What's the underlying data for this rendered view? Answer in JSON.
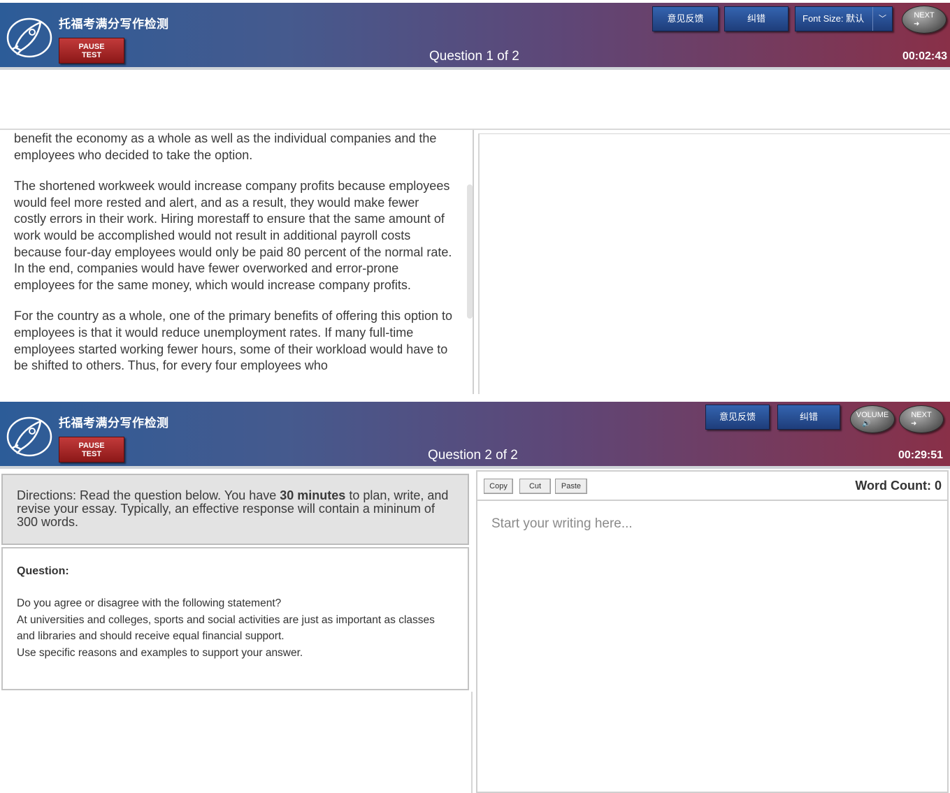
{
  "screen1": {
    "header": {
      "app_title": "托福考满分写作检测",
      "pause_label_1": "PAUSE",
      "pause_label_2": "TEST",
      "question_counter": "Question 1 of 2",
      "timer": "00:02:43",
      "feedback_label": "意见反馈",
      "correction_label": "纠错",
      "font_size_label": "Font Size: 默认",
      "next_label": "NEXT"
    },
    "passage": [
      "benefit the economy as a whole as well as the individual companies and the employees who decided to take the option.",
      "The shortened workweek would increase company profits because employees would feel more rested and alert, and as a result, they would make fewer costly errors in their work. Hiring morestaff to ensure that the same amount of work would be accomplished would not result in additional payroll costs because four-day employees would only be paid 80 percent of the normal rate. In the end, companies would have fewer overworked and error-prone employees for the same money, which would increase company profits.",
      "For the country as a whole, one of the primary benefits of offering this option to employees is that it would reduce unemployment rates. If many full-time employees started working fewer hours, some of their workload would have to be shifted to others. Thus, for every four employees who"
    ]
  },
  "screen2": {
    "header": {
      "app_title": "托福考满分写作检测",
      "pause_label_1": "PAUSE",
      "pause_label_2": "TEST",
      "question_counter": "Question 2 of 2",
      "timer": "00:29:51",
      "feedback_label": "意见反馈",
      "correction_label": "纠错",
      "volume_label": "VOLUME",
      "next_label": "NEXT"
    },
    "directions": {
      "before": "Directions: Read the question below. You have ",
      "bold": "30 minutes",
      "after": " to plan, write, and revise your essay. Typically, an effective response will contain a mininum of 300 words."
    },
    "question": {
      "heading": "Question:",
      "lines": [
        "Do you agree or disagree with the following statement?",
        "At universities and colleges, sports and social activities are just as important as classes and libraries and should receive equal financial support.",
        "Use specific reasons and examples to support your answer."
      ]
    },
    "editor": {
      "copy_label": "Copy",
      "cut_label": "Cut",
      "paste_label": "Paste",
      "word_count_label": "Word Count: 0",
      "placeholder": "Start your writing here..."
    }
  }
}
